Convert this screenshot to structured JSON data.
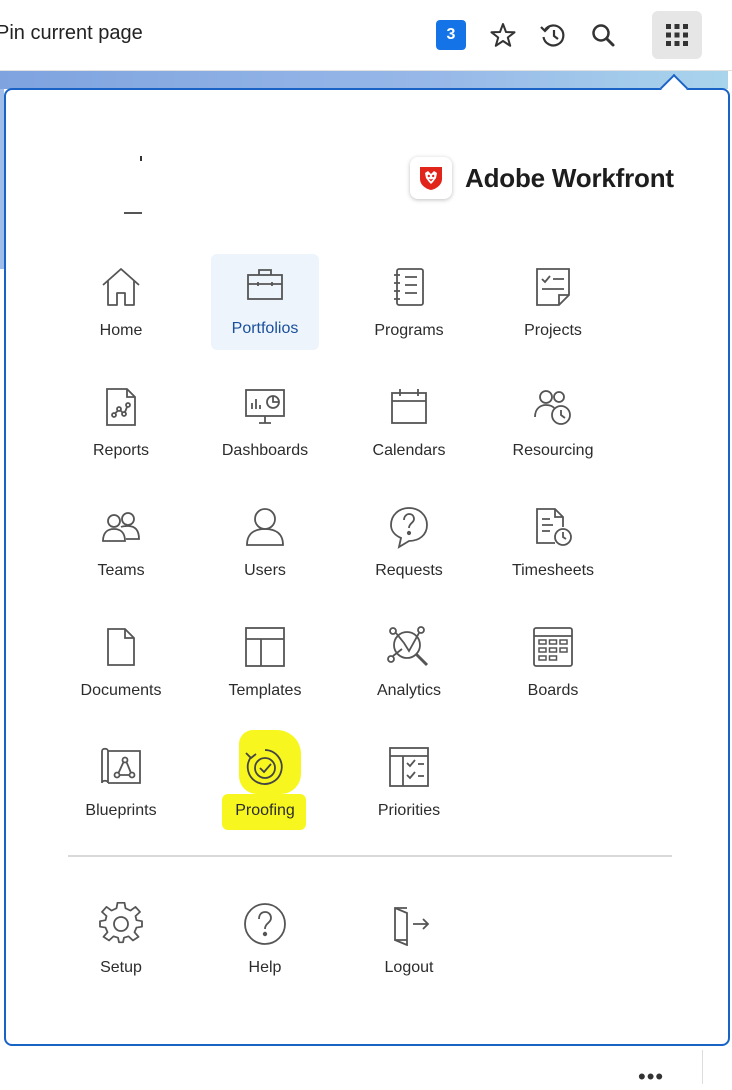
{
  "topbar": {
    "pin_label": "Pin current page",
    "badge_count": "3",
    "icons": [
      "star-icon",
      "history-icon",
      "search-icon",
      "grid-menu-icon"
    ]
  },
  "panel": {
    "brand_name": "Adobe Workfront",
    "brand_color": "#e1251b",
    "accent_color": "#1a63c6",
    "highlight_color": "#f7f71f",
    "items": [
      {
        "label": "Home",
        "icon": "home-icon"
      },
      {
        "label": "Portfolios",
        "icon": "portfolio-icon"
      },
      {
        "label": "Programs",
        "icon": "programs-icon"
      },
      {
        "label": "Projects",
        "icon": "projects-icon"
      },
      {
        "label": "Reports",
        "icon": "reports-icon"
      },
      {
        "label": "Dashboards",
        "icon": "dashboards-icon"
      },
      {
        "label": "Calendars",
        "icon": "calendar-icon"
      },
      {
        "label": "Resourcing",
        "icon": "resourcing-icon"
      },
      {
        "label": "Teams",
        "icon": "teams-icon"
      },
      {
        "label": "Users",
        "icon": "user-icon"
      },
      {
        "label": "Requests",
        "icon": "requests-icon"
      },
      {
        "label": "Timesheets",
        "icon": "timesheets-icon"
      },
      {
        "label": "Documents",
        "icon": "document-icon"
      },
      {
        "label": "Templates",
        "icon": "templates-icon"
      },
      {
        "label": "Analytics",
        "icon": "analytics-icon"
      },
      {
        "label": "Boards",
        "icon": "boards-icon"
      },
      {
        "label": "Blueprints",
        "icon": "blueprints-icon"
      },
      {
        "label": "Proofing",
        "icon": "proofing-icon"
      },
      {
        "label": "Priorities",
        "icon": "priorities-icon"
      }
    ],
    "footer_items": [
      {
        "label": "Setup",
        "icon": "gear-icon"
      },
      {
        "label": "Help",
        "icon": "help-icon"
      },
      {
        "label": "Logout",
        "icon": "logout-icon"
      }
    ]
  },
  "more_label": "•••"
}
